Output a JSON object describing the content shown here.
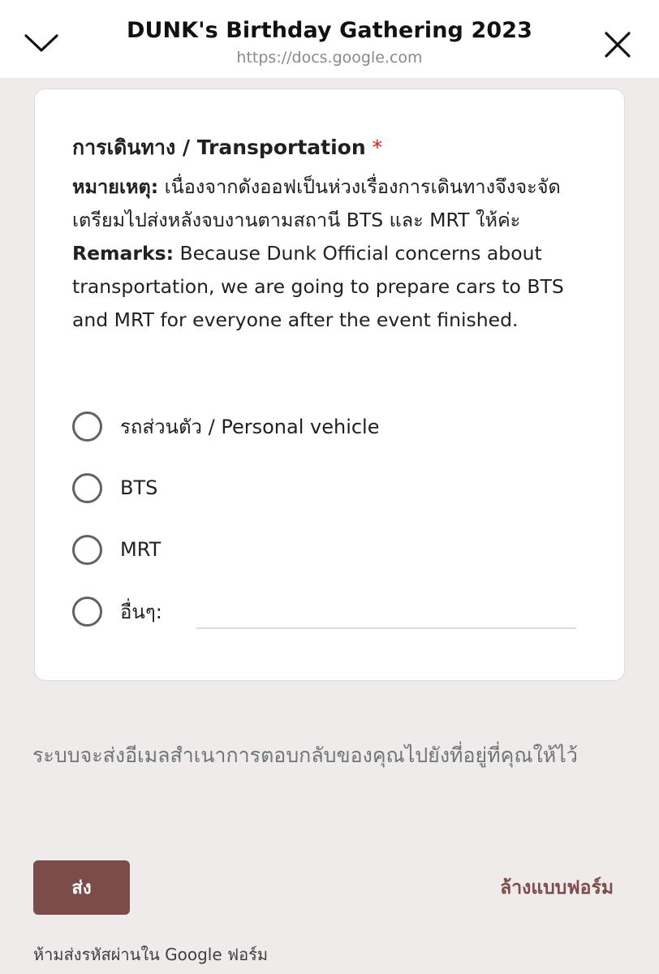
{
  "header": {
    "title": "DUNK's Birthday Gathering 2023",
    "url": "https://docs.google.com",
    "back_icon": "chevron-down-icon",
    "close_icon": "close-icon"
  },
  "question": {
    "title": "การเดินทาง / Transportation",
    "required_mark": "*",
    "note_th_label": "หมายเหตุ:",
    "note_th_text": "เนื่องจากดังออฟเป็นห่วงเรื่องการเดินทางจึงจะจัดเตรียมไปส่งหลังจบงานตามสถานี BTS และ MRT ให้ค่ะ",
    "note_en_label": "Remarks:",
    "note_en_text": "Because Dunk Official concerns about transportation, we are going to prepare cars to BTS and MRT for everyone after the event finished.",
    "options": [
      {
        "label": "รถส่วนตัว / Personal vehicle"
      },
      {
        "label": "BTS"
      },
      {
        "label": "MRT"
      },
      {
        "label": "อื่นๆ:"
      }
    ],
    "other_input_value": ""
  },
  "notice": "ระบบจะส่งอีเมลสำเนาการตอบกลับของคุณไปยังที่อยู่ที่คุณให้ไว้",
  "actions": {
    "submit_label": "ส่ง",
    "clear_label": "ล้างแบบฟอร์ม"
  },
  "footer": "ห้ามส่งรหัสผ่านใน Google ฟอร์ม",
  "colors": {
    "accent": "#7b4c49",
    "background": "#efebea",
    "required": "#c5221f"
  }
}
